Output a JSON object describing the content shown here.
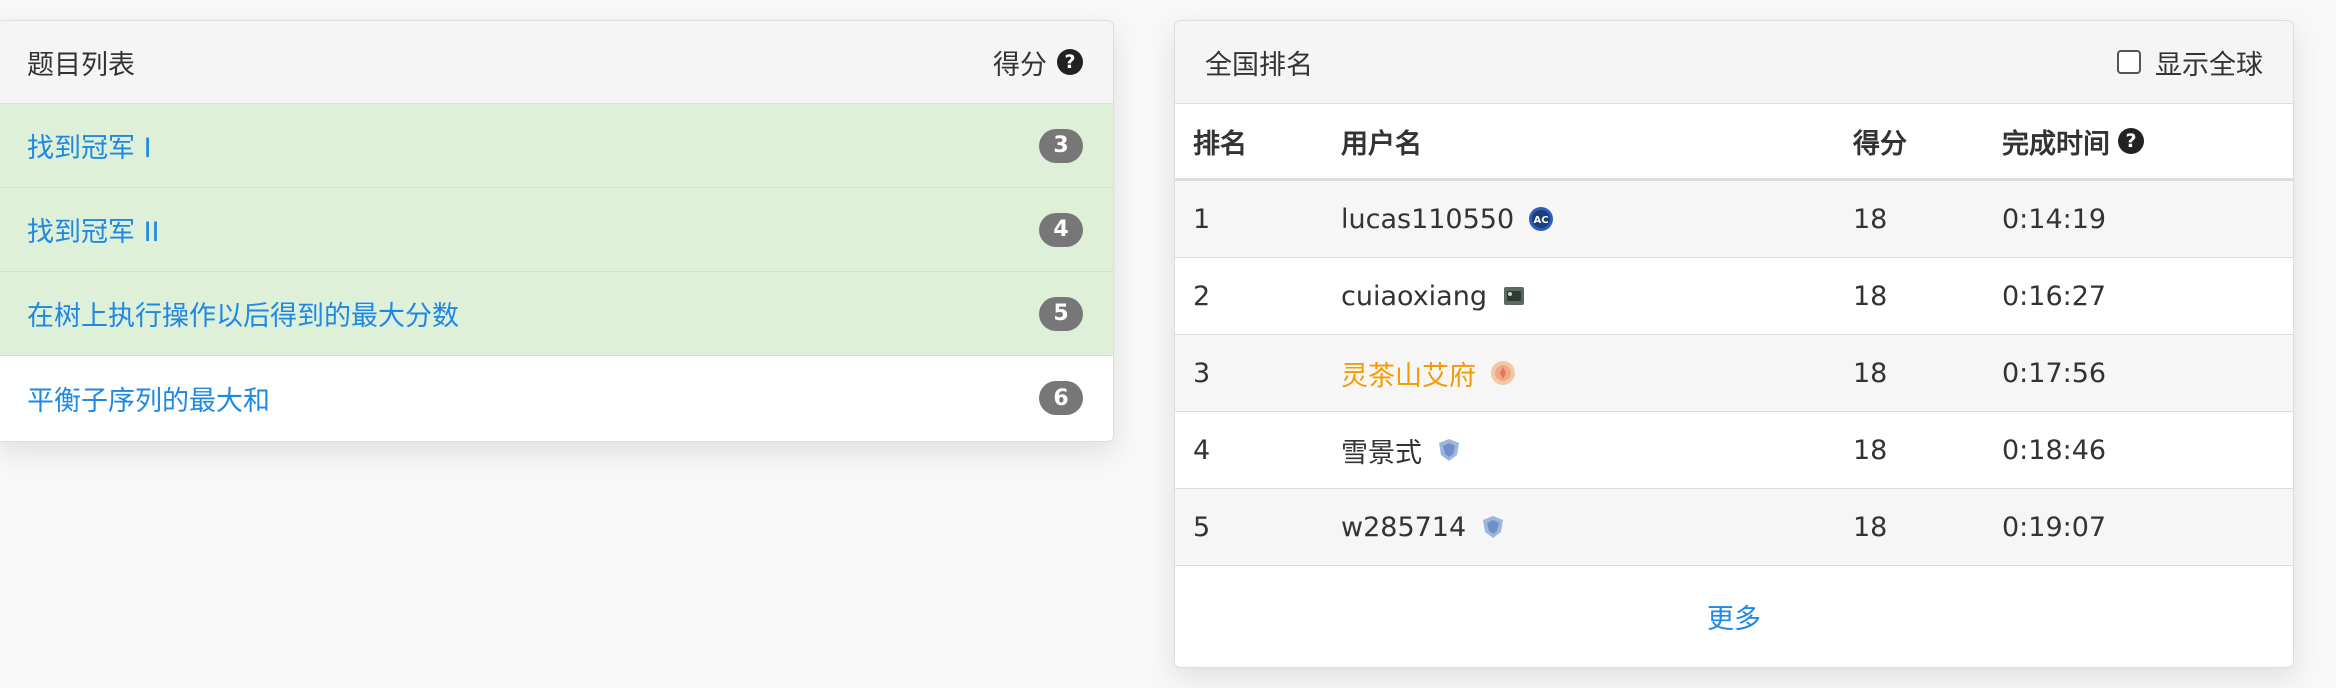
{
  "problems": {
    "header_title": "题目列表",
    "header_score": "得分",
    "items": [
      {
        "title": "找到冠军 I",
        "score": "3",
        "solved": true
      },
      {
        "title": "找到冠军 II",
        "score": "4",
        "solved": true
      },
      {
        "title": "在树上执行操作以后得到的最大分数",
        "score": "5",
        "solved": true
      },
      {
        "title": "平衡子序列的最大和",
        "score": "6",
        "solved": false
      }
    ]
  },
  "ranking": {
    "header_title": "全国排名",
    "show_global_label": "显示全球",
    "columns": {
      "rank": "排名",
      "username": "用户名",
      "score": "得分",
      "time": "完成时间"
    },
    "rows": [
      {
        "rank": "1",
        "username": "lucas110550",
        "score": "18",
        "time": "0:14:19",
        "icon": "ac-badge-icon"
      },
      {
        "rank": "2",
        "username": "cuiaoxiang",
        "score": "18",
        "time": "0:16:27",
        "icon": "guardian-badge-icon"
      },
      {
        "rank": "3",
        "username": "灵茶山艾府",
        "score": "18",
        "time": "0:17:56",
        "icon": "knight-badge-icon"
      },
      {
        "rank": "4",
        "username": "雪景式",
        "score": "18",
        "time": "0:18:46",
        "icon": "shield-badge-icon"
      },
      {
        "rank": "5",
        "username": "w285714",
        "score": "18",
        "time": "0:19:07",
        "icon": "shield-badge-icon"
      }
    ],
    "more_label": "更多"
  },
  "colors": {
    "link": "#1e88e5",
    "solved_row": "#dff0d8",
    "badge": "#777777",
    "highlight_user": "#f59b00"
  }
}
